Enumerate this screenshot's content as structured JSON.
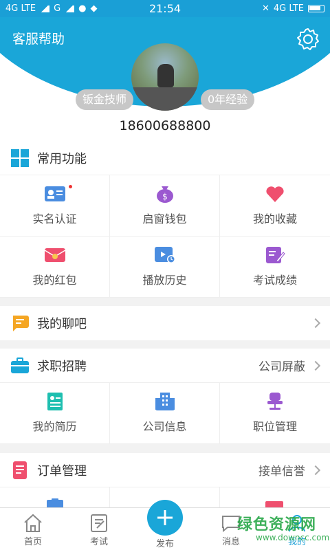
{
  "status": {
    "left": "4G LTE",
    "left2": "G",
    "time": "21:54",
    "right": "4G LTE"
  },
  "header": {
    "help": "客服帮助",
    "badge_left": "钣金技师",
    "badge_right": "0年经验",
    "phone": "18600688800"
  },
  "common": {
    "title": "常用功能",
    "items": [
      "实名认证",
      "启窗钱包",
      "我的收藏",
      "我的红包",
      "播放历史",
      "考试成绩"
    ]
  },
  "chat": {
    "title": "我的聊吧"
  },
  "jobs": {
    "title": "求职招聘",
    "extra": "公司屏蔽",
    "items": [
      "我的简历",
      "公司信息",
      "职位管理"
    ]
  },
  "orders": {
    "title": "订单管理",
    "extra": "接单信誉"
  },
  "nav": {
    "home": "首页",
    "exam": "考试",
    "publish": "发布",
    "message": "消息",
    "mine": "我的"
  },
  "watermark": {
    "title": "绿色资源网",
    "url": "www.downcc.com"
  },
  "colors": {
    "primary": "#1aa6d8",
    "bg": "#f2f2f2",
    "watermark": "#2aa84a"
  }
}
